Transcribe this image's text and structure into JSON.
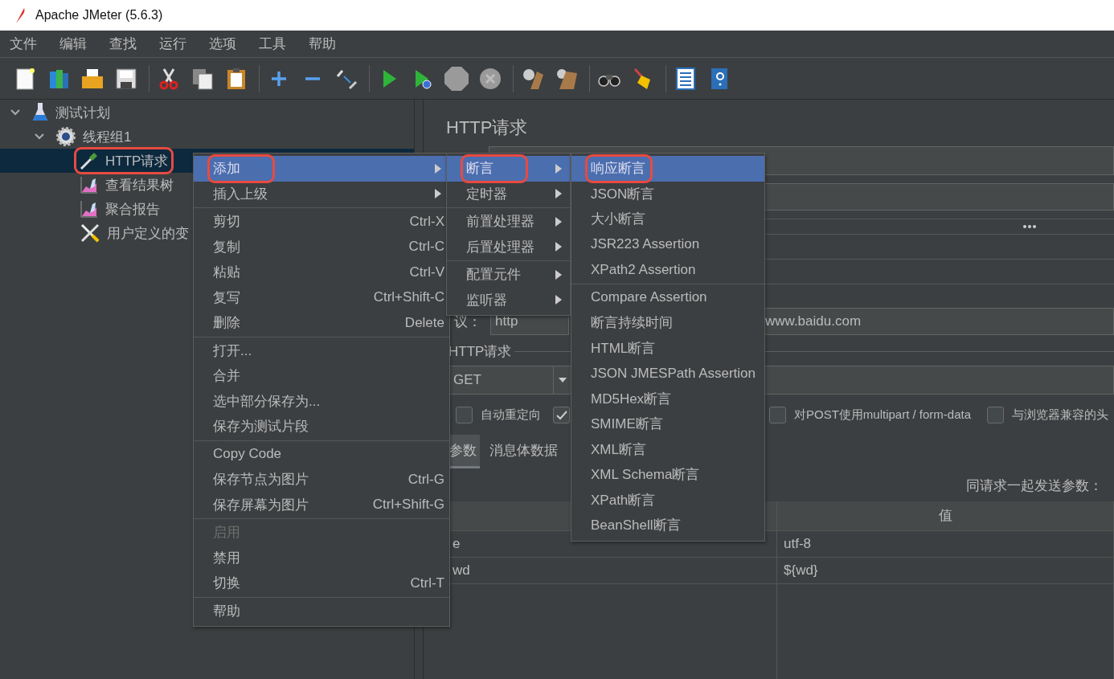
{
  "window": {
    "title": "Apache JMeter (5.6.3)"
  },
  "menubar": [
    "文件",
    "编辑",
    "查找",
    "运行",
    "选项",
    "工具",
    "帮助"
  ],
  "tree": [
    {
      "label": "测试计划",
      "kind": "plan",
      "expanded": true,
      "selected": false,
      "annotated": false,
      "children": [
        {
          "label": "线程组1",
          "kind": "thread-group",
          "expanded": true,
          "selected": false,
          "annotated": false,
          "children": [
            {
              "label": "HTTP请求",
              "kind": "sampler",
              "selected": true,
              "annotated": true
            },
            {
              "label": "查看结果树",
              "kind": "listener",
              "selected": false,
              "annotated": false
            },
            {
              "label": "聚合报告",
              "kind": "listener",
              "selected": false,
              "annotated": false
            },
            {
              "label": "用户定义的变",
              "kind": "config",
              "selected": false,
              "annotated": false
            }
          ]
        }
      ]
    }
  ],
  "editor": {
    "title": "HTTP请求",
    "protocol_label": "议：",
    "protocol": "http",
    "server": "www.baidu.com",
    "request_group": "HTTP请求",
    "method": "GET",
    "checkboxes": [
      {
        "label": "自动重定向",
        "checked": false
      },
      {
        "checked": true
      },
      {
        "label": "对POST使用multipart / form-data",
        "checked": false
      },
      {
        "label": "与浏览器兼容的头",
        "checked": false
      }
    ],
    "tabs": [
      {
        "label": "参数",
        "selected": true
      },
      {
        "label": "消息体数据",
        "selected": false
      }
    ],
    "params_caption": "同请求一起发送参数：",
    "table": {
      "value_header": "值",
      "rows": [
        [
          "e",
          "utf-8"
        ],
        [
          "wd",
          "${wd}"
        ]
      ]
    }
  },
  "context_menus": [
    {
      "items": [
        {
          "kind": "item",
          "label": "添加",
          "submenu": true,
          "selected": true,
          "annotated": true,
          "disabled": false
        },
        {
          "kind": "item",
          "label": "插入上级",
          "submenu": true,
          "selected": false,
          "annotated": false,
          "disabled": false
        },
        {
          "kind": "separator"
        },
        {
          "kind": "item",
          "label": "剪切",
          "shortcut": "Ctrl-X",
          "selected": false,
          "annotated": false,
          "disabled": false
        },
        {
          "kind": "item",
          "label": "复制",
          "shortcut": "Ctrl-C",
          "selected": false,
          "annotated": false,
          "disabled": false
        },
        {
          "kind": "item",
          "label": "粘贴",
          "shortcut": "Ctrl-V",
          "selected": false,
          "annotated": false,
          "disabled": false
        },
        {
          "kind": "item",
          "label": "复写",
          "shortcut": "Ctrl+Shift-C",
          "selected": false,
          "annotated": false,
          "disabled": false
        },
        {
          "kind": "item",
          "label": "删除",
          "shortcut": "Delete",
          "selected": false,
          "annotated": false,
          "disabled": false
        },
        {
          "kind": "separator"
        },
        {
          "kind": "item",
          "label": "打开...",
          "selected": false,
          "annotated": false,
          "disabled": false
        },
        {
          "kind": "item",
          "label": "合并",
          "selected": false,
          "annotated": false,
          "disabled": false
        },
        {
          "kind": "item",
          "label": "选中部分保存为...",
          "selected": false,
          "annotated": false,
          "disabled": false
        },
        {
          "kind": "item",
          "label": "保存为测试片段",
          "selected": false,
          "annotated": false,
          "disabled": false
        },
        {
          "kind": "separator"
        },
        {
          "kind": "item",
          "label": "Copy Code",
          "selected": false,
          "annotated": false,
          "disabled": false
        },
        {
          "kind": "item",
          "label": "保存节点为图片",
          "shortcut": "Ctrl-G",
          "selected": false,
          "annotated": false,
          "disabled": false
        },
        {
          "kind": "item",
          "label": "保存屏幕为图片",
          "shortcut": "Ctrl+Shift-G",
          "selected": false,
          "annotated": false,
          "disabled": false
        },
        {
          "kind": "separator"
        },
        {
          "kind": "item",
          "label": "启用",
          "selected": false,
          "annotated": false,
          "disabled": true
        },
        {
          "kind": "item",
          "label": "禁用",
          "selected": false,
          "annotated": false,
          "disabled": false
        },
        {
          "kind": "item",
          "label": "切换",
          "shortcut": "Ctrl-T",
          "selected": false,
          "annotated": false,
          "disabled": false
        },
        {
          "kind": "separator"
        },
        {
          "kind": "item",
          "label": "帮助",
          "selected": false,
          "annotated": false,
          "disabled": false
        }
      ]
    },
    {
      "items": [
        {
          "kind": "item",
          "label": "断言",
          "submenu": true,
          "selected": true,
          "annotated": true,
          "disabled": false
        },
        {
          "kind": "item",
          "label": "定时器",
          "submenu": true,
          "selected": false,
          "annotated": false,
          "disabled": false
        },
        {
          "kind": "separator"
        },
        {
          "kind": "item",
          "label": "前置处理器",
          "submenu": true,
          "selected": false,
          "annotated": false,
          "disabled": false
        },
        {
          "kind": "item",
          "label": "后置处理器",
          "submenu": true,
          "selected": false,
          "annotated": false,
          "disabled": false
        },
        {
          "kind": "separator"
        },
        {
          "kind": "item",
          "label": "配置元件",
          "submenu": true,
          "selected": false,
          "annotated": false,
          "disabled": false
        },
        {
          "kind": "item",
          "label": "监听器",
          "submenu": true,
          "selected": false,
          "annotated": false,
          "disabled": false
        }
      ]
    },
    {
      "items": [
        {
          "kind": "item",
          "label": "响应断言",
          "selected": true,
          "annotated": true,
          "disabled": false
        },
        {
          "kind": "item",
          "label": "JSON断言",
          "selected": false,
          "annotated": false,
          "disabled": false
        },
        {
          "kind": "item",
          "label": "大小断言",
          "selected": false,
          "annotated": false,
          "disabled": false
        },
        {
          "kind": "item",
          "label": "JSR223 Assertion",
          "selected": false,
          "annotated": false,
          "disabled": false
        },
        {
          "kind": "item",
          "label": "XPath2 Assertion",
          "selected": false,
          "annotated": false,
          "disabled": false
        },
        {
          "kind": "separator"
        },
        {
          "kind": "item",
          "label": "Compare Assertion",
          "selected": false,
          "annotated": false,
          "disabled": false
        },
        {
          "kind": "item",
          "label": "断言持续时间",
          "selected": false,
          "annotated": false,
          "disabled": false
        },
        {
          "kind": "item",
          "label": "HTML断言",
          "selected": false,
          "annotated": false,
          "disabled": false
        },
        {
          "kind": "item",
          "label": "JSON JMESPath Assertion",
          "selected": false,
          "annotated": false,
          "disabled": false
        },
        {
          "kind": "item",
          "label": "MD5Hex断言",
          "selected": false,
          "annotated": false,
          "disabled": false
        },
        {
          "kind": "item",
          "label": "SMIME断言",
          "selected": false,
          "annotated": false,
          "disabled": false
        },
        {
          "kind": "item",
          "label": "XML断言",
          "selected": false,
          "annotated": false,
          "disabled": false
        },
        {
          "kind": "item",
          "label": "XML Schema断言",
          "selected": false,
          "annotated": false,
          "disabled": false
        },
        {
          "kind": "item",
          "label": "XPath断言",
          "selected": false,
          "annotated": false,
          "disabled": false
        },
        {
          "kind": "item",
          "label": "BeanShell断言",
          "selected": false,
          "annotated": false,
          "disabled": false
        }
      ]
    }
  ]
}
